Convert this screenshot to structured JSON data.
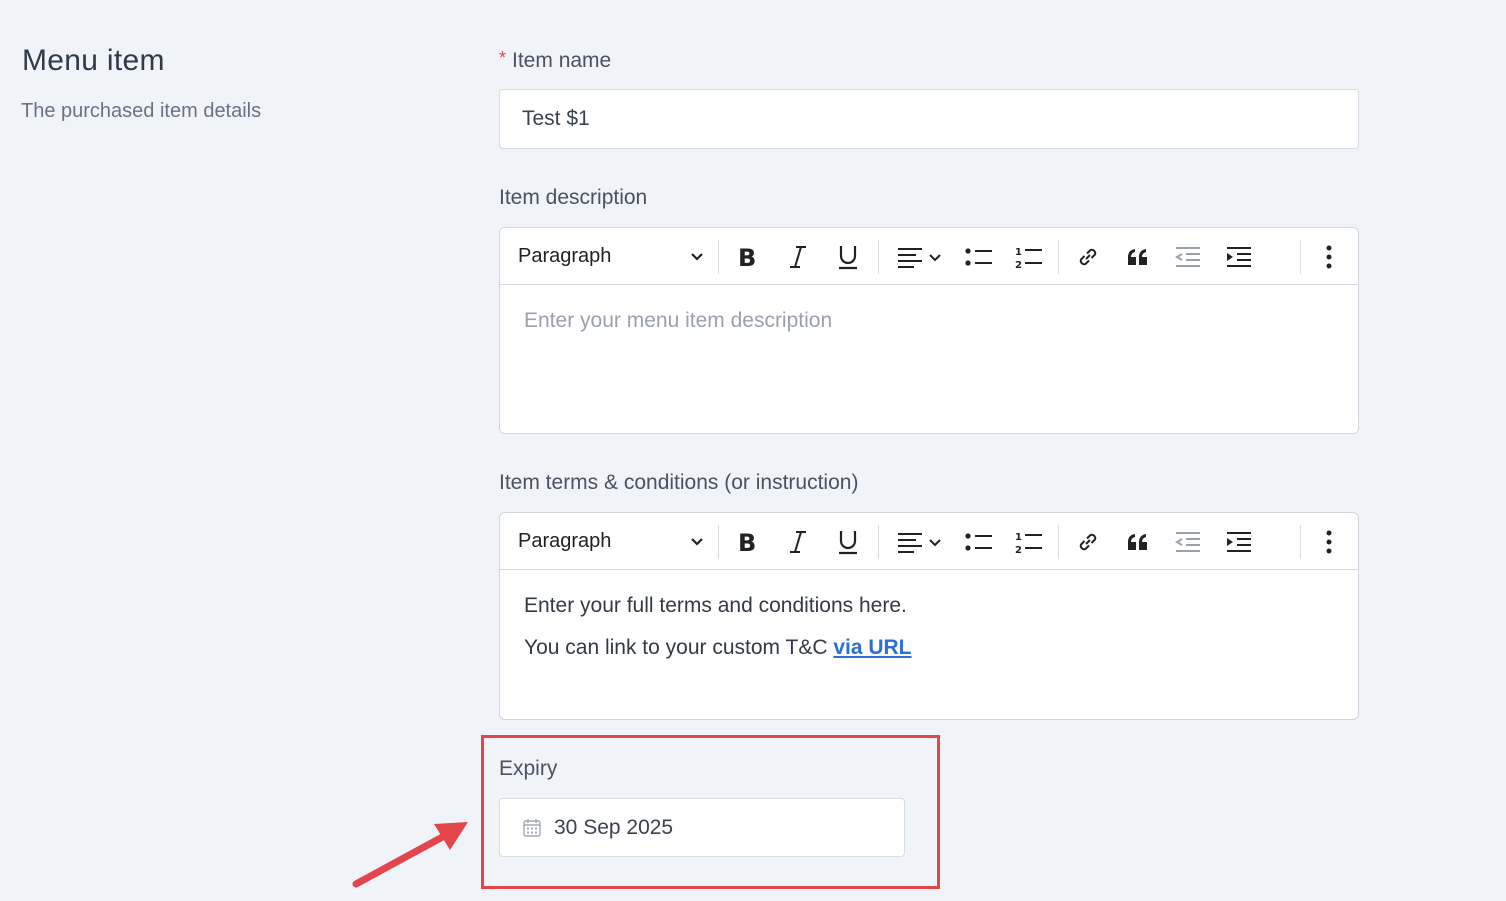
{
  "section": {
    "title": "Menu item",
    "subtitle": "The purchased item details"
  },
  "item_name": {
    "required_mark": "*",
    "label": "Item name",
    "value": "Test $1"
  },
  "description": {
    "label": "Item description",
    "block_format": "Paragraph",
    "placeholder": "Enter your menu item description"
  },
  "terms": {
    "label": "Item terms & conditions (or instruction)",
    "block_format": "Paragraph",
    "line1": "Enter your full terms and conditions here.",
    "line2_prefix": "You can link to your custom T&C ",
    "link_text": "via URL "
  },
  "expiry": {
    "label": "Expiry",
    "value": "30 Sep 2025"
  },
  "toolbar_icons": [
    "chevron-down-icon",
    "bold-icon",
    "italic-icon",
    "underline-icon",
    "align-icon",
    "bullet-list-icon",
    "numbered-list-icon",
    "link-icon",
    "quote-icon",
    "outdent-icon",
    "indent-icon",
    "more-vertical-icon"
  ],
  "colors": {
    "background": "#f0f3f8",
    "required": "#e5484d",
    "link": "#2d6fd8",
    "annotation": "#e2454a"
  }
}
